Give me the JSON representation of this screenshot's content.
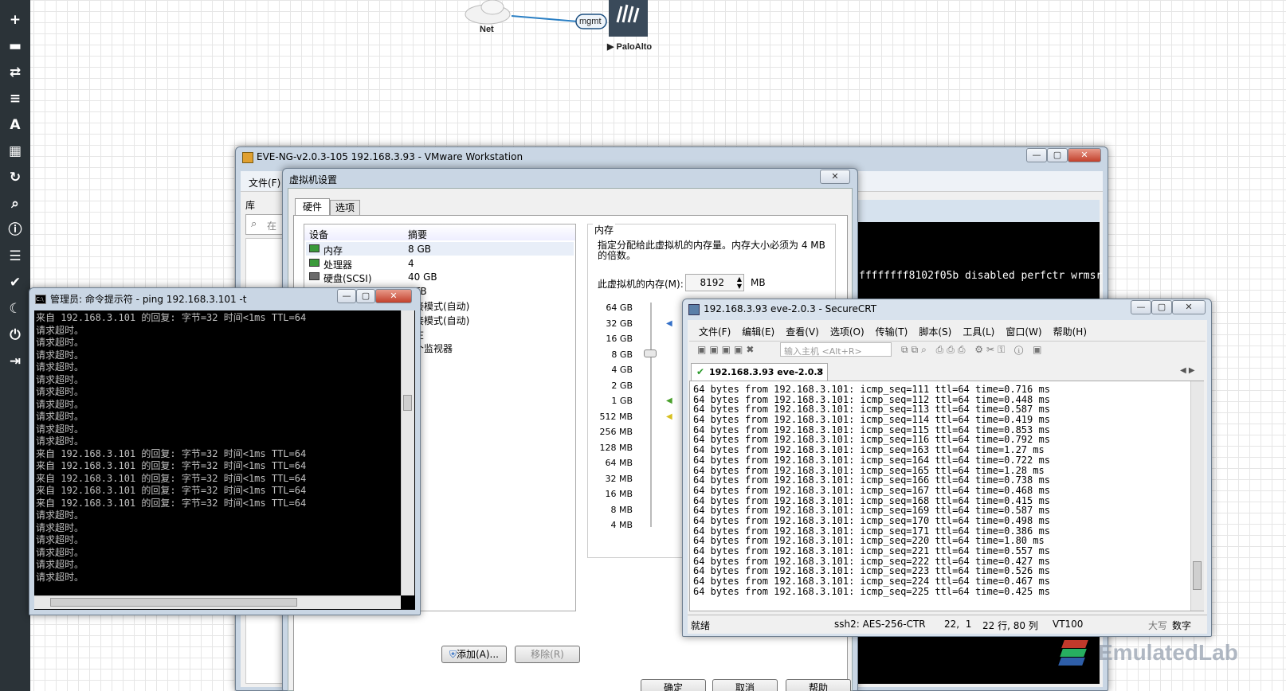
{
  "sidebar": {
    "icons": [
      "plus-icon",
      "drive-icon",
      "transfer-icon",
      "align-left-icon",
      "text-icon",
      "grid-icon",
      "refresh-icon",
      "zoom-icon",
      "info-icon",
      "list-icon",
      "check-icon",
      "moon-icon",
      "power-icon",
      "logout-icon"
    ],
    "glyphs": [
      "+",
      "▬",
      "⇄",
      "≡",
      "A",
      "▦",
      "↻",
      "⌕",
      "ⓘ",
      "☰",
      "✔",
      "☾",
      "⏻",
      "⇥"
    ]
  },
  "topology": {
    "cloud_label": "Net",
    "link_label": "mgmt",
    "device_label": "▶ PaloAlto"
  },
  "vmware": {
    "title": "EVE-NG-v2.0.3-105 192.168.3.93 - VMware Workstation",
    "menu_file": "文件(F)",
    "library_label": "库",
    "search_placeholder": "在",
    "console_text": "ffffffff8102f05b disabled perfctr wrmsr"
  },
  "vm_settings": {
    "title": "虚拟机设置",
    "tabs": [
      "硬件",
      "选项"
    ],
    "columns": [
      "设备",
      "摘要"
    ],
    "devices": [
      {
        "name": "内存",
        "summary": "8 GB"
      },
      {
        "name": "处理器",
        "summary": "4"
      },
      {
        "name": "硬盘(SCSI)",
        "summary": "40 GB"
      },
      {
        "name": "",
        "summary": "TB"
      },
      {
        "name": "",
        "summary": "接模式(自动)"
      },
      {
        "name": "",
        "summary": "接模式(自动)"
      },
      {
        "name": "",
        "summary": "在"
      },
      {
        "name": "",
        "summary": "个监视器"
      }
    ],
    "memory_group": "内存",
    "memory_desc": "指定分配给此虚拟机的内存量。内存大小必须为 4 MB 的倍数。",
    "memory_field_label": "此虚拟机的内存(M):",
    "memory_value": "8192",
    "memory_unit": "MB",
    "scale": [
      "64 GB",
      "32 GB",
      "16 GB",
      "8 GB",
      "4 GB",
      "2 GB",
      "1 GB",
      "512 MB",
      "256 MB",
      "128 MB",
      "64 MB",
      "32 MB",
      "16 MB",
      "8 MB",
      "4 MB"
    ],
    "add_button": "添加(A)...",
    "remove_button": "移除(R)",
    "ok_button": "确定",
    "cancel_button": "取消",
    "help_button": "帮助"
  },
  "cmd": {
    "title": "管理员: 命令提示符 - ping  192.168.3.101 -t",
    "lines": [
      "来自 192.168.3.101 的回复: 字节=32 时间<1ms TTL=64",
      "请求超时。",
      "请求超时。",
      "请求超时。",
      "请求超时。",
      "请求超时。",
      "请求超时。",
      "请求超时。",
      "请求超时。",
      "请求超时。",
      "请求超时。",
      "来自 192.168.3.101 的回复: 字节=32 时间<1ms TTL=64",
      "来自 192.168.3.101 的回复: 字节=32 时间<1ms TTL=64",
      "来自 192.168.3.101 的回复: 字节=32 时间<1ms TTL=64",
      "来自 192.168.3.101 的回复: 字节=32 时间<1ms TTL=64",
      "来自 192.168.3.101 的回复: 字节=32 时间<1ms TTL=64",
      "请求超时。",
      "请求超时。",
      "请求超时。",
      "请求超时。",
      "请求超时。",
      "请求超时。"
    ]
  },
  "securecrt": {
    "title": "192.168.3.93 eve-2.0.3 - SecureCRT",
    "menu": [
      "文件(F)",
      "编辑(E)",
      "查看(V)",
      "选项(O)",
      "传输(T)",
      "脚本(S)",
      "工具(L)",
      "窗口(W)",
      "帮助(H)"
    ],
    "host_placeholder": "输入主机 <Alt+R>",
    "tab_label": "192.168.3.93 eve-2.0.3",
    "lines": [
      "64 bytes from 192.168.3.101: icmp_seq=111 ttl=64 time=0.716 ms",
      "64 bytes from 192.168.3.101: icmp_seq=112 ttl=64 time=0.448 ms",
      "64 bytes from 192.168.3.101: icmp_seq=113 ttl=64 time=0.587 ms",
      "64 bytes from 192.168.3.101: icmp_seq=114 ttl=64 time=0.419 ms",
      "64 bytes from 192.168.3.101: icmp_seq=115 ttl=64 time=0.853 ms",
      "64 bytes from 192.168.3.101: icmp_seq=116 ttl=64 time=0.792 ms",
      "64 bytes from 192.168.3.101: icmp_seq=163 ttl=64 time=1.27 ms",
      "64 bytes from 192.168.3.101: icmp_seq=164 ttl=64 time=0.722 ms",
      "64 bytes from 192.168.3.101: icmp_seq=165 ttl=64 time=1.28 ms",
      "64 bytes from 192.168.3.101: icmp_seq=166 ttl=64 time=0.738 ms",
      "64 bytes from 192.168.3.101: icmp_seq=167 ttl=64 time=0.468 ms",
      "64 bytes from 192.168.3.101: icmp_seq=168 ttl=64 time=0.415 ms",
      "64 bytes from 192.168.3.101: icmp_seq=169 ttl=64 time=0.587 ms",
      "64 bytes from 192.168.3.101: icmp_seq=170 ttl=64 time=0.498 ms",
      "64 bytes from 192.168.3.101: icmp_seq=171 ttl=64 time=0.386 ms",
      "64 bytes from 192.168.3.101: icmp_seq=220 ttl=64 time=1.80 ms",
      "64 bytes from 192.168.3.101: icmp_seq=221 ttl=64 time=0.557 ms",
      "64 bytes from 192.168.3.101: icmp_seq=222 ttl=64 time=0.427 ms",
      "64 bytes from 192.168.3.101: icmp_seq=223 ttl=64 time=0.526 ms",
      "64 bytes from 192.168.3.101: icmp_seq=224 ttl=64 time=0.467 ms",
      "64 bytes from 192.168.3.101: icmp_seq=225 ttl=64 time=0.425 ms"
    ],
    "status_ready": "就绪",
    "status_cipher": "ssh2: AES-256-CTR",
    "status_cursor": "22,  1",
    "status_size": "22 行, 80 列",
    "status_term": "VT100",
    "status_caps": "大写",
    "status_num": "数字"
  },
  "watermark": "EmulatedLab"
}
